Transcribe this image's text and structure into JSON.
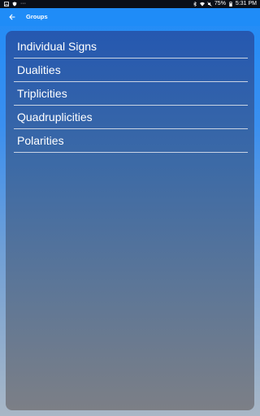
{
  "status_bar": {
    "battery": "75%",
    "time": "5:31 PM",
    "icons": [
      "gallery-icon",
      "shield-icon",
      "overflow-dots-icon",
      "bluetooth-icon",
      "wifi-icon",
      "mute-icon",
      "battery-icon"
    ]
  },
  "app_bar": {
    "back_icon": "arrow-left-icon",
    "title": "Groups"
  },
  "groups": {
    "items": [
      {
        "label": "Individual Signs"
      },
      {
        "label": "Dualities"
      },
      {
        "label": "Triplicities"
      },
      {
        "label": "Quadruplicities"
      },
      {
        "label": "Polarities"
      }
    ]
  },
  "colors": {
    "app_bar": "#1f8cf7",
    "panel_top": "#2558b0",
    "panel_bottom": "#7c7f86",
    "divider": "#c9d3e3",
    "status_bar": "#0a0f18"
  }
}
